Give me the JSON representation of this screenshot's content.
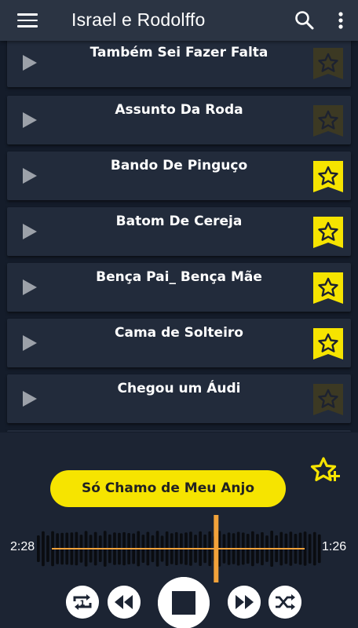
{
  "app_bar": {
    "title": "Israel e Rodolffo",
    "menu_icon": "hamburger-menu-icon",
    "search_icon": "search-icon",
    "more_icon": "more-vert-icon"
  },
  "songs": [
    {
      "title": "Também Sei Fazer Falta",
      "favorite": false
    },
    {
      "title": "Assunto Da Roda",
      "favorite": false
    },
    {
      "title": "Bando De Pinguço",
      "favorite": true
    },
    {
      "title": "Batom De Cereja",
      "favorite": true
    },
    {
      "title": "Bença Pai_ Bença Mãe",
      "favorite": true
    },
    {
      "title": "Cama de Solteiro",
      "favorite": true
    },
    {
      "title": "Chegou um Áudi",
      "favorite": false
    }
  ],
  "player": {
    "now_playing": "Só Chamo de Meu Anjo",
    "elapsed": "2:28",
    "remaining": "1:26",
    "progress": 0.63,
    "favorite_icon": "star-add-icon",
    "controls": [
      "repeat-one-icon",
      "rewind-icon",
      "stop-icon",
      "fast-forward-icon",
      "shuffle-icon"
    ]
  },
  "colors": {
    "accent_yellow": "#f6e400",
    "progress_orange": "#f2a23a",
    "app_bar": "#2b3443",
    "list_item": "#222b3b",
    "background": "#141c2a"
  }
}
